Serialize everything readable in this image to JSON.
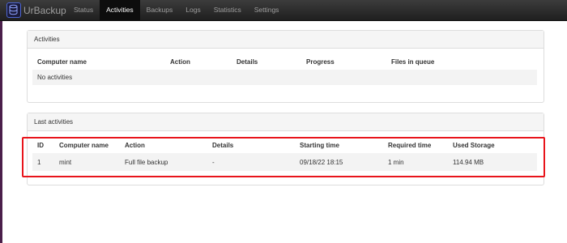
{
  "app": {
    "brand": "UrBackup"
  },
  "nav": {
    "items": [
      {
        "label": "Status"
      },
      {
        "label": "Activities"
      },
      {
        "label": "Backups"
      },
      {
        "label": "Logs"
      },
      {
        "label": "Statistics"
      },
      {
        "label": "Settings"
      }
    ],
    "active_index": 1
  },
  "activities_panel": {
    "title": "Activities",
    "columns": [
      "Computer name",
      "Action",
      "Details",
      "Progress",
      "Files in queue"
    ],
    "empty_message": "No activities"
  },
  "last_activities_panel": {
    "title": "Last activities",
    "columns": [
      "ID",
      "Computer name",
      "Action",
      "Details",
      "Starting time",
      "Required time",
      "Used Storage"
    ],
    "rows": [
      {
        "id": "1",
        "computer_name": "mint",
        "action": "Full file backup",
        "details": "-",
        "starting_time": "09/18/22 18:15",
        "required_time": "1 min",
        "used_storage": "114.94 MB"
      }
    ]
  },
  "colors": {
    "highlight": "#e8141b",
    "navbar": "#222222",
    "accent": "#4d66d4"
  }
}
